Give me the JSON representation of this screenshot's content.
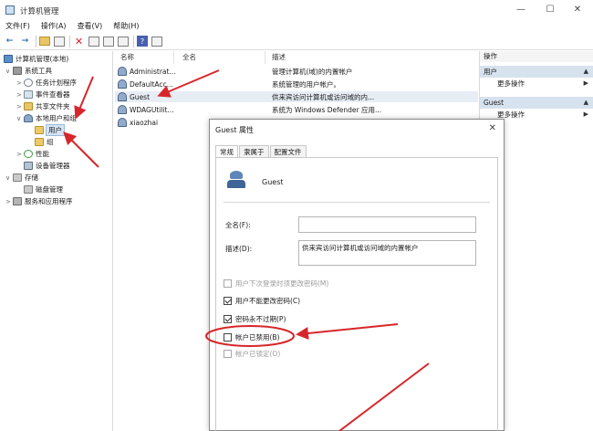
{
  "window": {
    "title": "计算机管理",
    "min_glyph": "—",
    "max_glyph": "☐",
    "close_glyph": "✕"
  },
  "menu": [
    "文件(F)",
    "操作(A)",
    "查看(V)",
    "帮助(H)"
  ],
  "toolbar": {
    "back_glyph": "←",
    "forward_glyph": "→",
    "delete_glyph": "✕",
    "help_glyph": "?"
  },
  "tree": {
    "root": "计算机管理(本地)",
    "system_tools": "系统工具",
    "task_scheduler": "任务计划程序",
    "event_viewer": "事件查看器",
    "shared_folders": "共享文件夹",
    "local_users_groups": "本地用户和组",
    "users": "用户",
    "groups": "组",
    "performance": "性能",
    "device_manager": "设备管理器",
    "storage": "存储",
    "disk_management": "磁盘管理",
    "services_apps": "服务和应用程序"
  },
  "list": {
    "headers": {
      "name": "名称",
      "full_name": "全名",
      "description": "描述"
    },
    "rows": [
      {
        "name": "Administrat...",
        "full_name": "",
        "description": "管理计算机(域)的内置帐户"
      },
      {
        "name": "DefaultAcc...",
        "full_name": "",
        "description": "系统管理的用户帐户。"
      },
      {
        "name": "Guest",
        "full_name": "",
        "description": "供来宾访问计算机或访问域的内..."
      },
      {
        "name": "WDAGUtilit...",
        "full_name": "",
        "description": "系统为 Windows Defender 应用..."
      },
      {
        "name": "xiaozhai",
        "full_name": "",
        "description": ""
      }
    ]
  },
  "actions": {
    "header": "操作",
    "section1": "用户",
    "more1": "更多操作",
    "section2": "Guest",
    "more2": "更多操作"
  },
  "dialog": {
    "title": "Guest 属性",
    "close_glyph": "✕",
    "tabs": [
      "常规",
      "隶属于",
      "配置文件"
    ],
    "username": "Guest",
    "full_name_label": "全名(F):",
    "full_name_value": "",
    "description_label": "描述(D):",
    "description_value": "供来宾访问计算机或访问域的内置帐户",
    "checkboxes": [
      {
        "label": "用户下次登录时须更改密码(M)",
        "checked": false,
        "disabled": true
      },
      {
        "label": "用户不能更改密码(C)",
        "checked": true,
        "disabled": false
      },
      {
        "label": "密码永不过期(P)",
        "checked": true,
        "disabled": false
      },
      {
        "label": "帐户已禁用(B)",
        "checked": false,
        "disabled": false
      },
      {
        "label": "帐户已锁定(O)",
        "checked": false,
        "disabled": true
      }
    ]
  },
  "colors": {
    "annotation_red": "#d7262b",
    "selection_blue": "#d7e2ef"
  }
}
